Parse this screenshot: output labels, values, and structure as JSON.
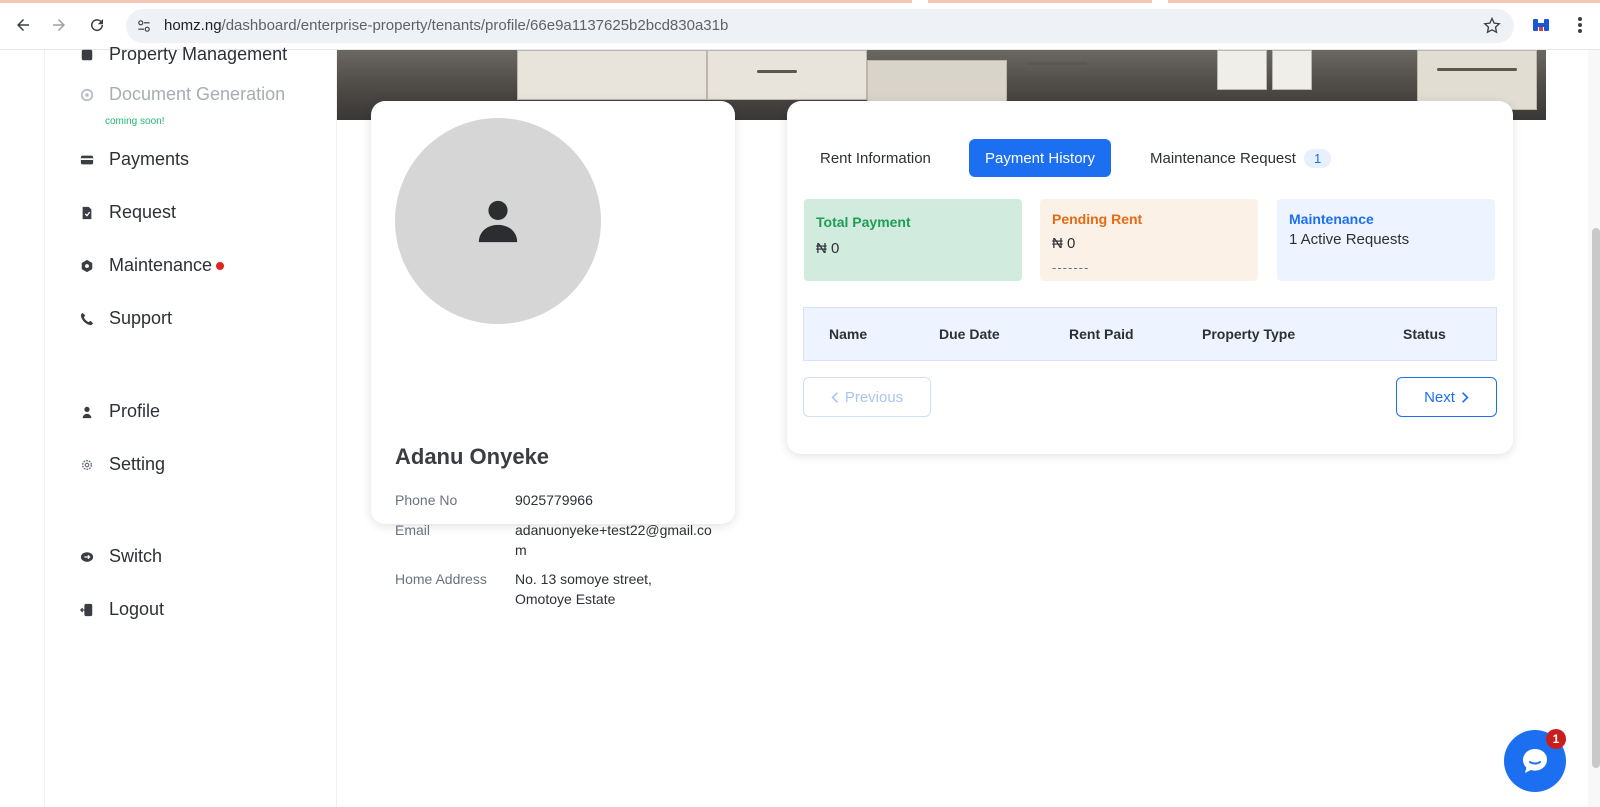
{
  "browser": {
    "url_host": "homz.ng",
    "url_path": "/dashboard/enterprise-property/tenants/profile/66e9a1137625b2bcd830a31b"
  },
  "sidebar": {
    "items": [
      {
        "label": "Property Management",
        "icon": "building-icon"
      },
      {
        "label": "Document Generation",
        "icon": "document-icon",
        "note": "coming soon!"
      },
      {
        "label": "Payments",
        "icon": "card-icon"
      },
      {
        "label": "Request",
        "icon": "request-icon"
      },
      {
        "label": "Maintenance",
        "icon": "hexagon-icon"
      },
      {
        "label": "Support",
        "icon": "phone-icon"
      },
      {
        "label": "Profile",
        "icon": "user-icon"
      },
      {
        "label": "Setting",
        "icon": "gear-icon"
      },
      {
        "label": "Switch",
        "icon": "switch-icon"
      },
      {
        "label": "Logout",
        "icon": "logout-icon"
      }
    ]
  },
  "profile": {
    "name": "Adanu Onyeke",
    "phone_label": "Phone No",
    "phone": "9025779966",
    "email_label": "Email",
    "email": "adanuonyeke+test22@gmail.com",
    "address_label": "Home Address",
    "address": "No. 13 somoye street, Omotoye Estate"
  },
  "tabs": {
    "rent_info": "Rent Information",
    "payment_history": "Payment History",
    "maintenance_request": "Maintenance Request",
    "maintenance_count": "1"
  },
  "stats": {
    "total_payment_title": "Total Payment",
    "total_payment_value": "₦ 0",
    "pending_rent_title": "Pending Rent",
    "pending_rent_value": "₦ 0",
    "pending_rent_placeholder": "-------",
    "maintenance_title": "Maintenance",
    "maintenance_value": "1 Active Requests"
  },
  "table": {
    "columns": [
      "Name",
      "Due Date",
      "Rent Paid",
      "Property Type",
      "Status"
    ]
  },
  "pagination": {
    "previous": "Previous",
    "next": "Next"
  },
  "chat": {
    "badge": "1"
  },
  "colors": {
    "accent": "#1d6ff2",
    "success": "#1f9d55",
    "warning": "#e46a14",
    "danger": "#e02424"
  }
}
